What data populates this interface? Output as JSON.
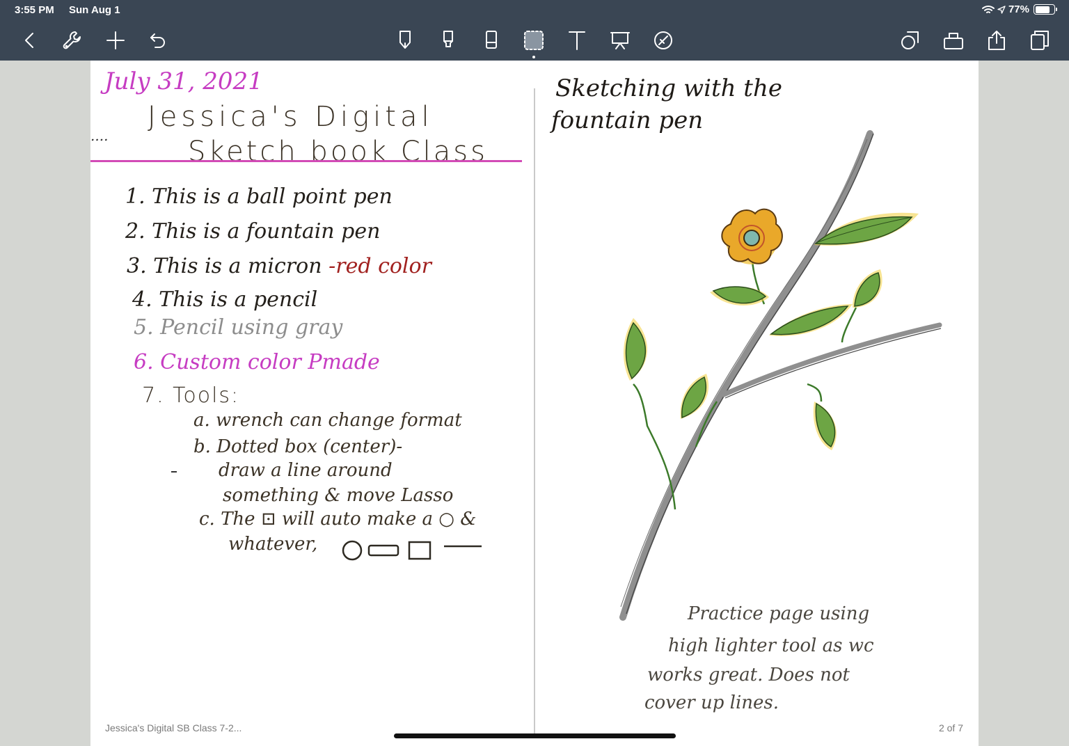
{
  "status": {
    "time": "3:55 PM",
    "date": "Sun Aug 1",
    "battery": "77%",
    "battery_level": 0.77
  },
  "toolbar": {
    "left_icons": [
      "back-chevron-icon",
      "wrench-icon",
      "plus-icon",
      "undo-icon"
    ],
    "center_tools": [
      "fountain-pen-icon",
      "highlighter-icon",
      "eraser-icon",
      "lasso-selection-icon",
      "text-tool-icon",
      "presentation-icon",
      "laser-pointer-icon"
    ],
    "right_icons": [
      "shapes-icon",
      "elements-icon",
      "share-icon",
      "pages-icon"
    ]
  },
  "left_page": {
    "date": "July 31, 2021",
    "title_line1": "Jessica's Digital",
    "title_line2": "Sketch book Class",
    "ellipsis": "....",
    "items": [
      "1. This is a ball point pen",
      "2. This is a fountain pen",
      "3. This is a micron",
      "4. This is a pencil",
      "5. Pencil using gray",
      "6. Custom color Pmade",
      "7. Tools:"
    ],
    "item3_suffix": "-red color",
    "subitems": [
      "a. wrench can change format",
      "b. Dotted box (center)-",
      "draw a line around",
      "something & move Lasso",
      "c. The ⊡ will auto make a ○ &",
      "whatever,"
    ]
  },
  "right_page": {
    "title_line1": "Sketching with the",
    "title_line2": "fountain pen",
    "note_lines": [
      "Practice page using",
      "high lighter tool as wc",
      "works great. Does not",
      "cover up lines."
    ]
  },
  "footer": {
    "doc_name": "Jessica's Digital SB Class 7-2...",
    "page_count": "2 of 7"
  },
  "colors": {
    "toolbar_bg": "#3a4654",
    "magenta_ink": "#c63cc2",
    "red_ink": "#a1211f",
    "gray_ink": "#8d8d8d",
    "rule": "#d24bb6"
  }
}
